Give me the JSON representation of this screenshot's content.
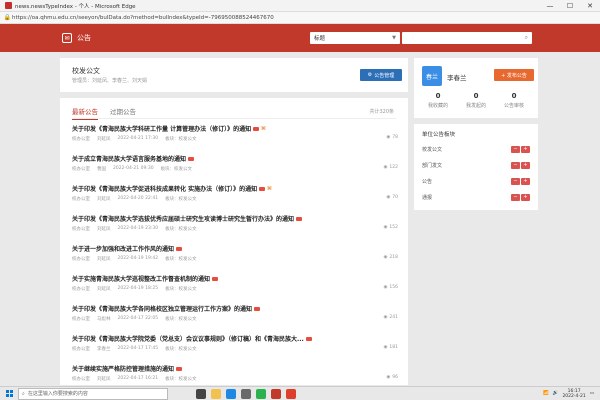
{
  "browser": {
    "title": "news.newsTypeIndex - 个人 - Microsoft Edge",
    "url": "https://oa.qhmu.edu.cn/seeyon/bulData.do?method=bulIndex&typeId=-796950088524467670",
    "window_controls": [
      "—",
      "☐",
      "✕"
    ]
  },
  "app_header": {
    "title": "公告",
    "select_value": "标题",
    "search_icon": "search-icon",
    "color": "#c0392b"
  },
  "section": {
    "title": "校发公文",
    "admins": "管理员：刘延凤、李春兰、刘天娟",
    "manage_button": "公告管理"
  },
  "list": {
    "tab_active": "最新公告",
    "tab_inactive": "过期公告",
    "total": "共计320条",
    "items": [
      {
        "title": "关于印发《青海民族大学科研工作量 计算管理办法（修订）》的通知",
        "dept": "校办公室",
        "author": "刘延凤",
        "date": "2022-04-21 17:30",
        "section": "板块：校发公文",
        "views": "78",
        "attach": true
      },
      {
        "title": "关于成立青海民族大学语言服务基地的通知",
        "dept": "校办公室",
        "author": "曹国",
        "date": "2022-04-21 09:30",
        "section": "板块：校发公文",
        "views": "122",
        "attach": false
      },
      {
        "title": "关于印发《青海民族大学促进科技成果转化 实施办法（修订）》的通知",
        "dept": "校办公室",
        "author": "刘延凤",
        "date": "2022-04-20 22:41",
        "section": "板块：校发公文",
        "views": "70",
        "attach": true
      },
      {
        "title": "关于印发《青海民族大学选拔优秀应届硕士研究生攻读博士研究生暂行办法》的通知",
        "dept": "校办公室",
        "author": "刘延凤",
        "date": "2022-04-19 23:30",
        "section": "板块：校发公文",
        "views": "152",
        "attach": false
      },
      {
        "title": "关于进一步加强和改进工作作风的通知",
        "dept": "校办公室",
        "author": "刘延凤",
        "date": "2022-04-19 19:42",
        "section": "板块：校发公文",
        "views": "218",
        "attach": false
      },
      {
        "title": "关于实施青海民族大学巡视整改工作督查机制的通知",
        "dept": "校办公室",
        "author": "刘延凤",
        "date": "2022-04-19 18:25",
        "section": "板块：校发公文",
        "views": "156",
        "attach": false
      },
      {
        "title": "关于印发《青海民族大学各同格校区独立管理运行工作方案》的通知",
        "dept": "校办公室",
        "author": "马彪林",
        "date": "2022-04-17 22:05",
        "section": "板块：校发公文",
        "views": "241",
        "attach": false
      },
      {
        "title": "关于印发《青海民族大学院党委（党总支）会议议事规则》（修订稿）和《青海民族大...",
        "dept": "校办公室",
        "author": "李春兰",
        "date": "2022-04-17 17:45",
        "section": "板块：校发公文",
        "views": "181",
        "attach": false
      },
      {
        "title": "关于继续实施严格防控管理措施的通知",
        "dept": "校办公室",
        "author": "刘延凤",
        "date": "2022-04-17 16:21",
        "section": "板块：校发公文",
        "views": "96",
        "attach": false
      }
    ]
  },
  "user": {
    "avatar_text": "春兰",
    "name": "李春兰",
    "publish_button": "+ 发布公告",
    "stats": [
      {
        "value": "0",
        "label": "我收藏的"
      },
      {
        "value": "0",
        "label": "我发起的"
      },
      {
        "value": "0",
        "label": "公告审核"
      }
    ]
  },
  "modules": {
    "title": "单位公告板块",
    "items": [
      "校发公文",
      "部门发文",
      "公告",
      "通报"
    ]
  },
  "taskbar": {
    "search_placeholder": "在这里输入你要搜索的内容",
    "time": "16:17",
    "date": "2022-4-21"
  }
}
